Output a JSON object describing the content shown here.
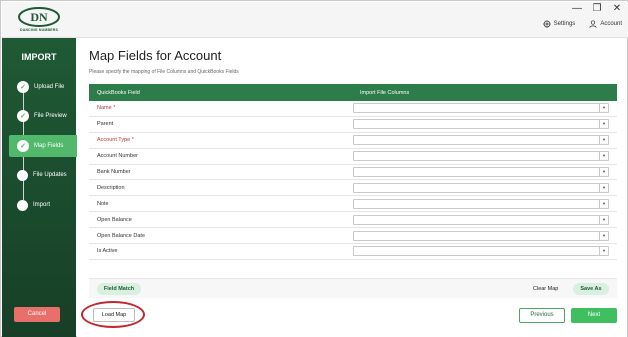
{
  "app": {
    "logo_text": "DN",
    "logo_subtitle": "DANCING NUMBERS"
  },
  "window": {
    "minimize": "—",
    "maximize": "❐",
    "close": "✕"
  },
  "header": {
    "settings_label": "Settings",
    "account_label": "Account"
  },
  "sidebar": {
    "title": "IMPORT",
    "steps": [
      {
        "label": "Upload File",
        "state": "done"
      },
      {
        "label": "File Preview",
        "state": "done"
      },
      {
        "label": "Map Fields",
        "state": "active"
      },
      {
        "label": "File Updates",
        "state": "pending"
      },
      {
        "label": "Import",
        "state": "pending"
      }
    ],
    "cancel_label": "Cancel"
  },
  "main": {
    "title": "Map Fields for Account",
    "subtitle": "Please specify the mapping of File Columns and QuickBooks Fields",
    "table": {
      "headers": [
        "QuickBooks Field",
        "Import File Columns"
      ],
      "rows": [
        {
          "field": "Name *",
          "required": true,
          "value": ""
        },
        {
          "field": "Parent",
          "required": false,
          "value": ""
        },
        {
          "field": "Account Type *",
          "required": true,
          "value": ""
        },
        {
          "field": "Account Number",
          "required": false,
          "value": ""
        },
        {
          "field": "Bank Number",
          "required": false,
          "value": ""
        },
        {
          "field": "Description",
          "required": false,
          "value": ""
        },
        {
          "field": "Note",
          "required": false,
          "value": ""
        },
        {
          "field": "Open Balance",
          "required": false,
          "value": ""
        },
        {
          "field": "Open Balance Date",
          "required": false,
          "value": ""
        },
        {
          "field": "Is Active",
          "required": false,
          "value": ""
        }
      ]
    },
    "field_match_label": "Field Match",
    "clear_map_label": "Clear Map",
    "save_as_label": "Save As",
    "load_map_label": "Load Map",
    "previous_label": "Previous",
    "next_label": "Next"
  },
  "colors": {
    "brand_green": "#1f5a35",
    "header_green": "#2c7d4a",
    "active_step": "#52b86c",
    "next_button": "#3fbf5f",
    "cancel_button": "#e8706a",
    "required_text": "#b63b34",
    "highlight_ring": "#c1272d"
  }
}
